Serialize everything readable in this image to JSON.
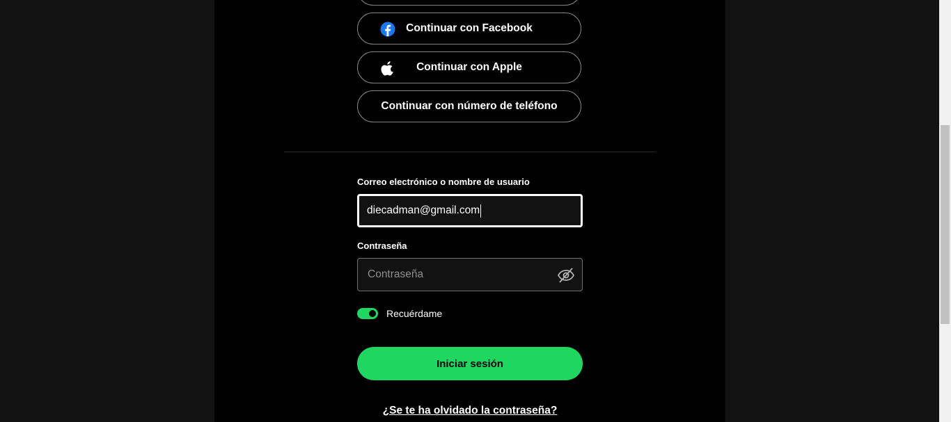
{
  "auth": {
    "buttons": [
      {
        "label": "Continuar con Facebook",
        "icon": "facebook-icon"
      },
      {
        "label": "Continuar con Apple",
        "icon": "apple-icon"
      },
      {
        "label": "Continuar con número de teléfono"
      }
    ]
  },
  "form": {
    "email_label": "Correo electrónico o nombre de usuario",
    "email_value": "diecadman@gmail.com",
    "password_label": "Contraseña",
    "password_placeholder": "Contraseña",
    "remember_label": "Recuérdame",
    "remember_on": true,
    "submit_label": "Iniciar sesión",
    "forgot_label": "¿Se te ha olvidado la contraseña?"
  },
  "colors": {
    "accent": "#1ed760",
    "facebook": "#1877f2"
  }
}
